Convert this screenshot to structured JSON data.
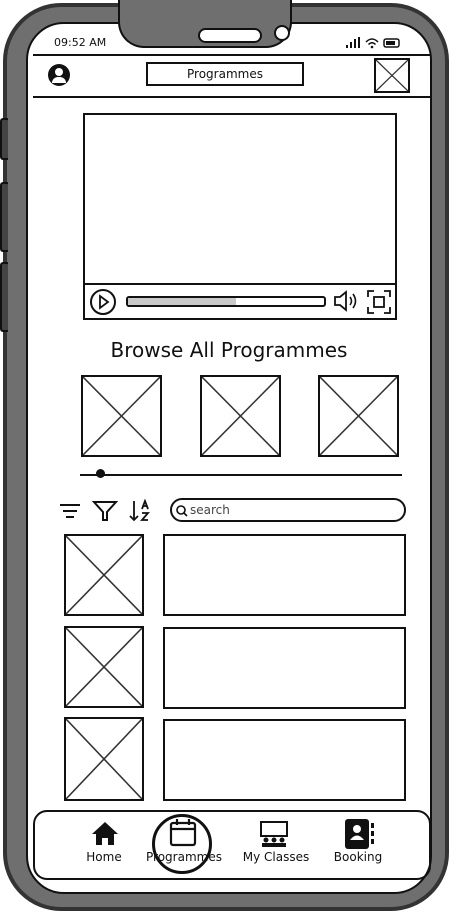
{
  "status_bar": {
    "time": "09:52 AM"
  },
  "header": {
    "title": "Programmes"
  },
  "section": {
    "heading": "Browse All Programmes"
  },
  "search": {
    "placeholder": "search"
  },
  "bottom_nav": {
    "items": [
      {
        "label": "Home",
        "icon": "home-icon"
      },
      {
        "label": "Programmes",
        "icon": "calendar-icon"
      },
      {
        "label": "My Classes",
        "icon": "classroom-icon"
      },
      {
        "label": "Booking",
        "icon": "contact-book-icon"
      }
    ],
    "active": "Programmes"
  },
  "video_player": {
    "progress": 0.55
  }
}
